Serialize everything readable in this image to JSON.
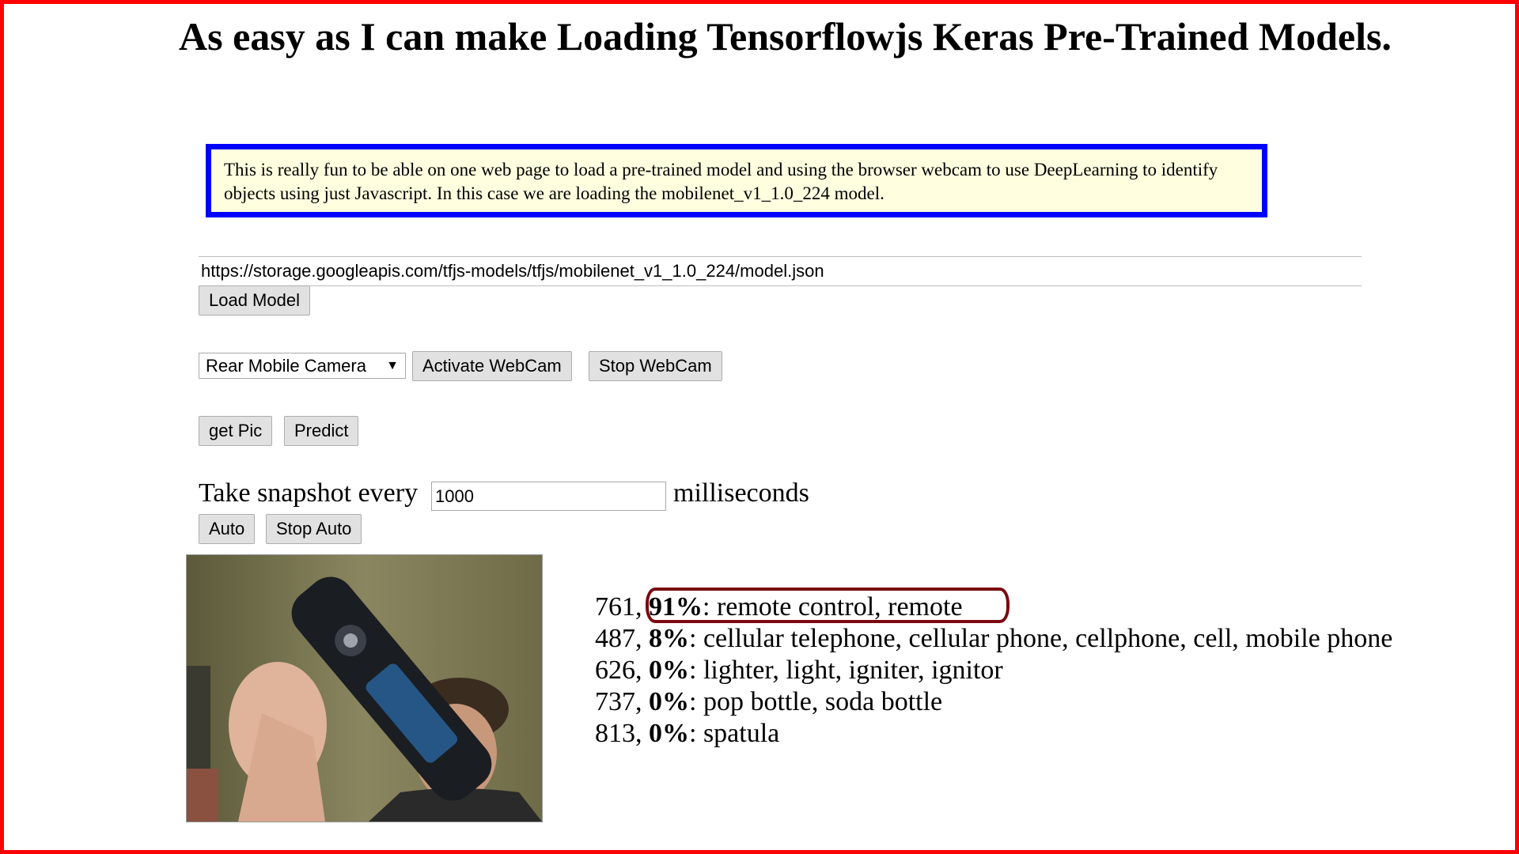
{
  "page": {
    "title": "As easy as I can make Loading Tensorflowjs Keras Pre-Trained Models.",
    "intro": "This is really fun to be able on one web page to load a pre-trained model and using the browser webcam to use DeepLearning to identify objects using just Javascript. In this case we are loading the mobilenet_v1_1.0_224 model."
  },
  "model": {
    "url_value": "https://storage.googleapis.com/tfjs-models/tfjs/mobilenet_v1_1.0_224/model.json",
    "load_label": "Load Model"
  },
  "camera": {
    "selected": "Rear Mobile Camera",
    "activate_label": "Activate WebCam",
    "stop_label": "Stop WebCam"
  },
  "actions": {
    "get_pic_label": "get Pic",
    "predict_label": "Predict"
  },
  "auto": {
    "prefix": "Take snapshot every",
    "interval_value": "1000",
    "suffix": "milliseconds",
    "auto_label": "Auto",
    "stop_auto_label": "Stop Auto"
  },
  "predictions": [
    {
      "id": "761,",
      "pct": "91%",
      "label": ": remote control, remote"
    },
    {
      "id": "487,",
      "pct": "8%",
      "label": ": cellular telephone, cellular phone, cellphone, cell, mobile phone"
    },
    {
      "id": "626,",
      "pct": "0%",
      "label": ": lighter, light, igniter, ignitor"
    },
    {
      "id": "737,",
      "pct": "0%",
      "label": ": pop bottle, soda bottle"
    },
    {
      "id": "813,",
      "pct": "0%",
      "label": ": spatula"
    }
  ],
  "colors": {
    "frame": "#ff0000",
    "intro_border": "#0000ff",
    "intro_bg": "#ffffe0",
    "highlight": "#7a0a10"
  }
}
